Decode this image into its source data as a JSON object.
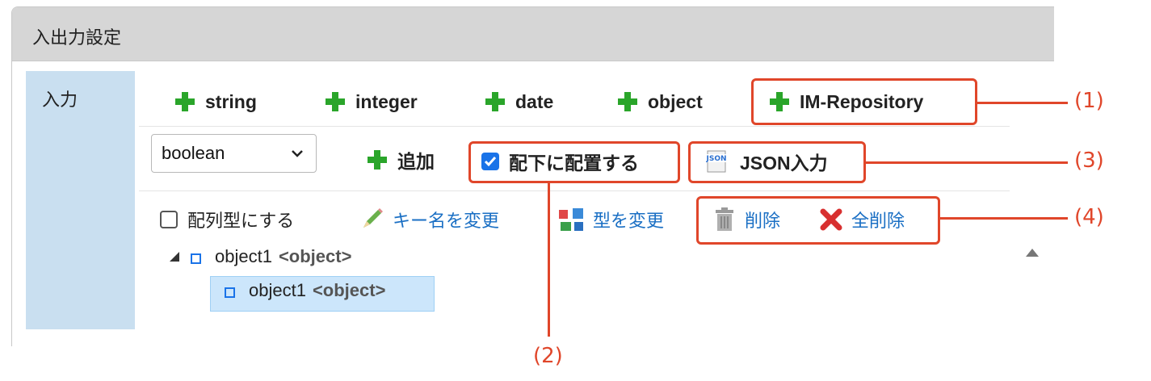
{
  "panel": {
    "title": "入出力設定"
  },
  "section": {
    "label": "入力"
  },
  "type_buttons": [
    {
      "label": "string"
    },
    {
      "label": "integer"
    },
    {
      "label": "date"
    },
    {
      "label": "object"
    },
    {
      "label": "IM-Repository"
    }
  ],
  "type_select": {
    "value": "boolean"
  },
  "add_button": {
    "label": "追加"
  },
  "place_under": {
    "label": "配下に配置する",
    "checked": true
  },
  "json_input": {
    "label": "JSON入力",
    "icon_text": "JSON"
  },
  "array_type": {
    "label": "配列型にする",
    "checked": false
  },
  "actions": {
    "rename_key": "キー名を変更",
    "change_type": "型を変更",
    "delete": "削除",
    "delete_all": "全削除"
  },
  "tree": [
    {
      "name": "object1",
      "type": "<object>",
      "expanded": true,
      "selected": false
    },
    {
      "name": "object1",
      "type": "<object>",
      "selected": true
    }
  ],
  "callouts": [
    "(1)",
    "(2)",
    "(3)",
    "(4)"
  ],
  "colors": {
    "callout": "#e0462a",
    "plus": "#2aa52a",
    "link": "#1a6fc4",
    "label_bg": "#c9dff0"
  }
}
